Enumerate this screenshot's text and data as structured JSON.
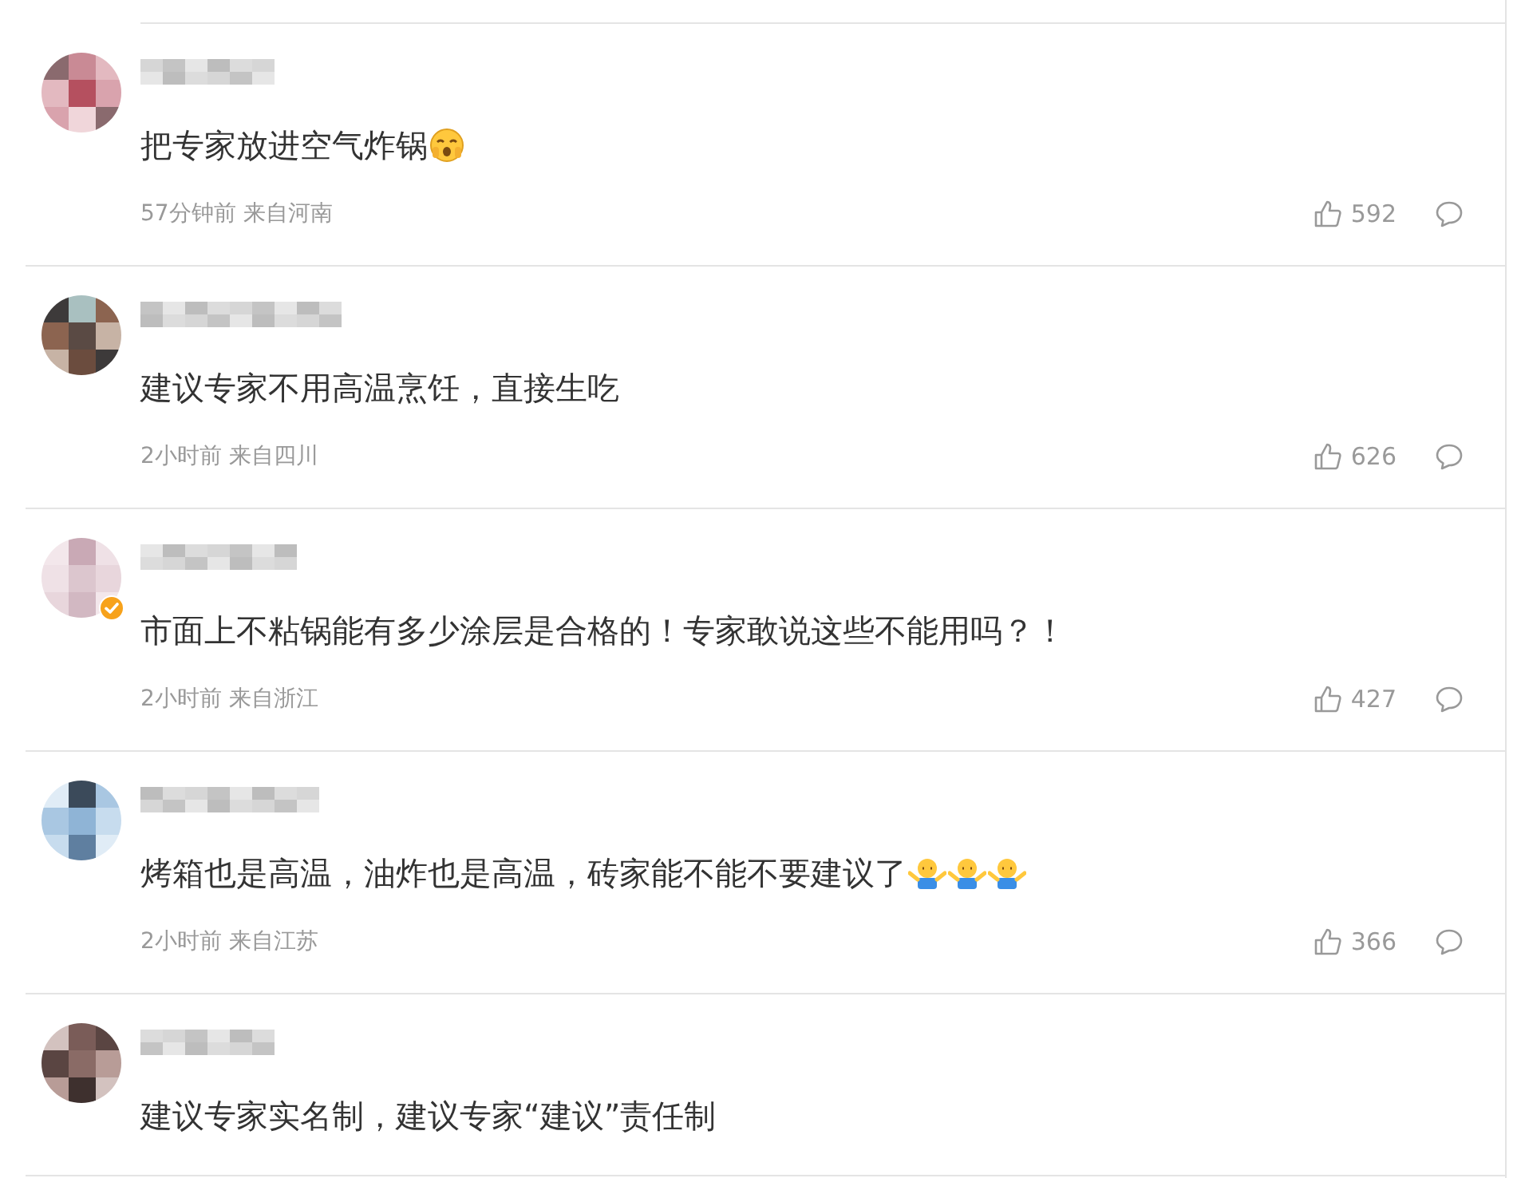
{
  "comments": [
    {
      "text": "把专家放进空气炸锅",
      "emoji": [
        {
          "kind": "face"
        }
      ],
      "verified": false,
      "time": "57分钟前",
      "source": "来自河南",
      "likes": "592"
    },
    {
      "text": "建议专家不用高温烹饪，直接生吃",
      "verified": false,
      "time": "2小时前",
      "source": "来自四川",
      "likes": "626"
    },
    {
      "text": "市面上不粘锅能有多少涂层是合格的！专家敢说这些不能用吗？！",
      "verified": true,
      "time": "2小时前",
      "source": "来自浙江",
      "likes": "427"
    },
    {
      "text": "烤箱也是高温，油炸也是高温，砖家能不能不要建议了",
      "emoji": [
        {
          "kind": "shrug"
        },
        {
          "kind": "shrug"
        },
        {
          "kind": "shrug"
        }
      ],
      "verified": false,
      "time": "2小时前",
      "source": "来自江苏",
      "likes": "366"
    },
    {
      "text": "建议专家实名制，建议专家“建议”责任制",
      "verified": false
    }
  ]
}
